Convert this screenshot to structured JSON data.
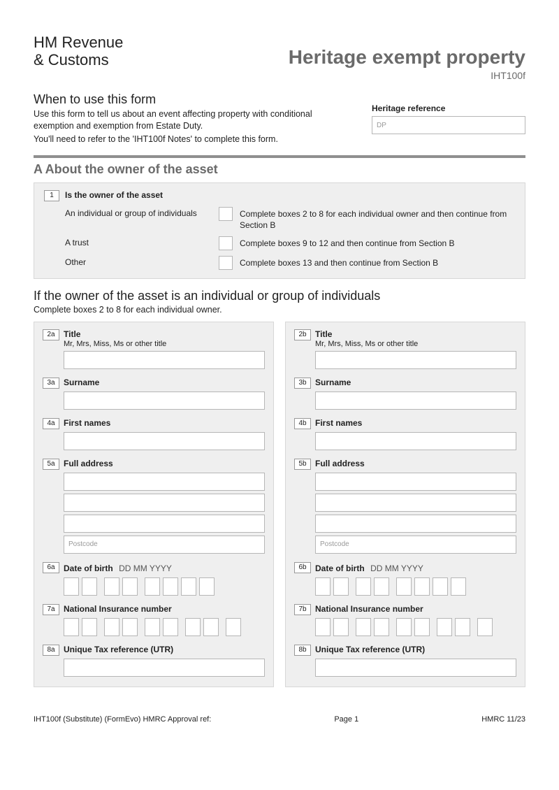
{
  "header": {
    "logo_line1": "HM Revenue",
    "logo_line2": "& Customs",
    "title": "Heritage exempt property",
    "form_code": "IHT100f"
  },
  "intro": {
    "subhead": "When to use this form",
    "p1": "Use this form to tell us about an event affecting property with conditional exemption and exemption from Estate Duty.",
    "p2": "You'll need to refer to the 'IHT100f Notes' to complete this form.",
    "ref_label": "Heritage reference",
    "ref_value": "DP"
  },
  "sectionA": {
    "heading": "A  About the owner of the asset",
    "q1": {
      "num": "1",
      "label": "Is the owner of the asset",
      "opts": [
        {
          "label": "An individual or group of individuals",
          "desc": "Complete boxes 2 to 8 for each individual owner and then continue from Section B"
        },
        {
          "label": "A trust",
          "desc": "Complete boxes 9 to 12 and then continue from Section B"
        },
        {
          "label": "Other",
          "desc": "Complete boxes 13 and then continue from Section B"
        }
      ]
    }
  },
  "individuals": {
    "heading": "If the owner of the asset is an individual or group of individuals",
    "desc": "Complete boxes 2 to 8 for each individual owner.",
    "fields": {
      "title": {
        "label": "Title",
        "hint": "Mr, Mrs, Miss, Ms or other title"
      },
      "surname": {
        "label": "Surname"
      },
      "first": {
        "label": "First names"
      },
      "address": {
        "label": "Full address",
        "postcode": "Postcode"
      },
      "dob": {
        "label": "Date of birth",
        "fmt": "DD MM YYYY"
      },
      "ni": {
        "label": "National Insurance number"
      },
      "utr": {
        "label": "Unique Tax reference (UTR)"
      }
    },
    "nums": {
      "a": {
        "title": "2a",
        "surname": "3a",
        "first": "4a",
        "address": "5a",
        "dob": "6a",
        "ni": "7a",
        "utr": "8a"
      },
      "b": {
        "title": "2b",
        "surname": "3b",
        "first": "4b",
        "address": "5b",
        "dob": "6b",
        "ni": "7b",
        "utr": "8b"
      }
    }
  },
  "footer": {
    "left": "IHT100f  (Substitute) (FormEvo) HMRC Approval ref:",
    "center": "Page 1",
    "right": "HMRC 11/23"
  }
}
